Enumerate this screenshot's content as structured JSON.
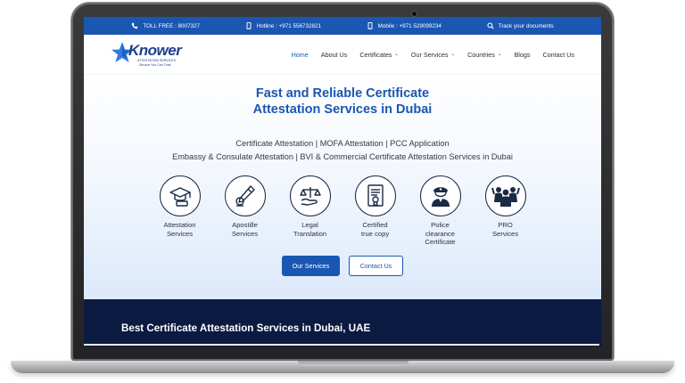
{
  "topbar": {
    "toll_free": "TOLL FREE : 8007327",
    "hotline": "Hotline : +971 556732821",
    "mobile": "Mobile : +971 529099234",
    "track": "Track your documents"
  },
  "logo": {
    "name": "Knower",
    "subtitle": "ATTESTATION SERVICES",
    "tagline": "Service You Can Trust"
  },
  "nav": {
    "items": [
      {
        "label": "Home",
        "active": true,
        "dropdown": false
      },
      {
        "label": "About Us",
        "active": false,
        "dropdown": false
      },
      {
        "label": "Certificates",
        "active": false,
        "dropdown": true
      },
      {
        "label": "Our Services",
        "active": false,
        "dropdown": true
      },
      {
        "label": "Countries",
        "active": false,
        "dropdown": true
      },
      {
        "label": "Blogs",
        "active": false,
        "dropdown": false
      },
      {
        "label": "Contact Us",
        "active": false,
        "dropdown": false
      }
    ],
    "caret": "⌄"
  },
  "hero": {
    "title_line1": "Fast and Reliable Certificate",
    "title_line2": "Attestation Services in Dubai",
    "sub_line1": "Certificate Attestation | MOFA Attestation | PCC Application",
    "sub_line2": "Embassy & Consulate Attestation | BVI & Commercial Certificate Attestation Services in Dubai"
  },
  "services": [
    {
      "line1": "Attestation",
      "line2": "Services",
      "line3": "",
      "icon": "graduation-cap-icon"
    },
    {
      "line1": "Apostille",
      "line2": "Services",
      "line3": "",
      "icon": "pen-seal-icon"
    },
    {
      "line1": "Legal",
      "line2": "Translation",
      "line3": "",
      "icon": "scales-icon"
    },
    {
      "line1": "Certified",
      "line2": "true copy",
      "line3": "",
      "icon": "certificate-icon"
    },
    {
      "line1": "Police",
      "line2": "clearance",
      "line3": "Certificate",
      "icon": "police-officer-icon"
    },
    {
      "line1": "PRO",
      "line2": "Services",
      "line3": "",
      "icon": "team-icon"
    }
  ],
  "buttons": {
    "primary": "Our Services",
    "secondary": "Contact Us"
  },
  "dark_section": {
    "title": "Best Certificate Attestation Services in Dubai, UAE"
  },
  "colors": {
    "brand_blue": "#1a57b2",
    "navy": "#0b1a41",
    "icon_stroke": "#1b2a44"
  }
}
